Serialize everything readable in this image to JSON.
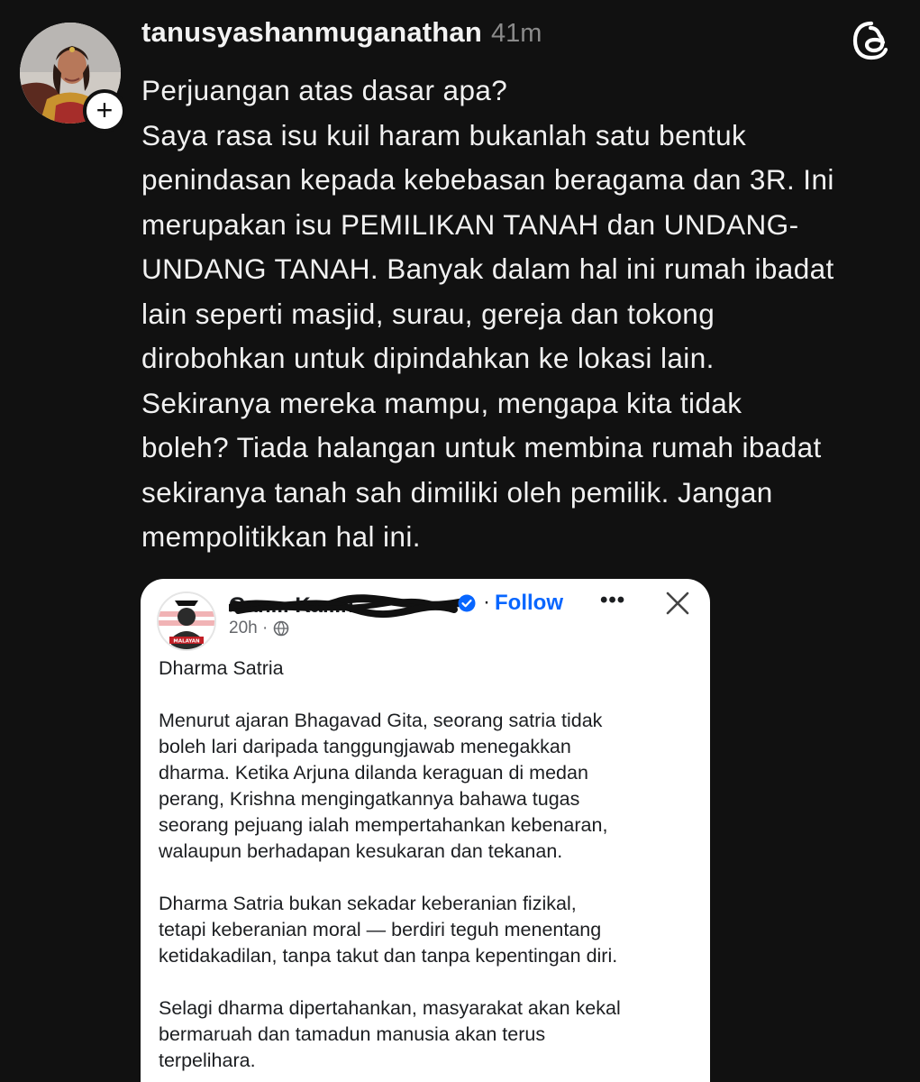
{
  "post": {
    "username": "tanusyashanmuganathan",
    "time": "41m",
    "body_lines": [
      "Perjuangan atas dasar apa?",
      "Saya rasa isu kuil haram bukanlah satu bentuk",
      "penindasan kepada kebebasan beragama dan 3R. Ini",
      "merupakan isu PEMILIKAN TANAH dan UNDANG-",
      "UNDANG TANAH. Banyak dalam hal ini rumah ibadat",
      "lain seperti masjid, surau, gereja dan tokong",
      "dirobohkan untuk dipindahkan ke lokasi lain.",
      "Sekiranya mereka mampu, mengapa kita tidak",
      "boleh? Tiada halangan untuk membina rumah ibadat",
      "sekiranya tanah sah dimiliki oleh pemilik. Jangan",
      "mempolitikkan hal ini."
    ],
    "icons": {
      "follow": "plus-icon",
      "app_logo": "threads-logo-icon"
    }
  },
  "embedded": {
    "author_visible": "Gan... Ka...n",
    "follow_label": "Follow",
    "separator": "·",
    "more": "•••",
    "time": "20h ·",
    "avatar_badge": "MALAYAN",
    "title": "Dharma Satria",
    "paragraph1": [
      "Menurut ajaran Bhagavad Gita, seorang satria tidak",
      "boleh lari daripada tanggungjawab menegakkan",
      "dharma. Ketika Arjuna dilanda keraguan di medan",
      "perang, Krishna mengingatkannya bahawa tugas",
      "seorang pejuang ialah mempertahankan kebenaran,",
      "walaupun berhadapan kesukaran dan tekanan."
    ],
    "paragraph2": [
      "Dharma Satria bukan sekadar keberanian fizikal,",
      "tetapi keberanian moral — berdiri teguh menentang",
      "ketidakadilan, tanpa takut dan tanpa kepentingan diri."
    ],
    "paragraph3": [
      "Selagi dharma dipertahankan, masyarakat akan kekal",
      "bermaruah dan tamadun manusia akan terus",
      "terpelihara."
    ]
  },
  "colors": {
    "background": "#111111",
    "text_primary": "#f1f1f1",
    "text_secondary": "#8a8a8a",
    "card_background": "#ffffff",
    "facebook_blue": "#0866ff"
  }
}
